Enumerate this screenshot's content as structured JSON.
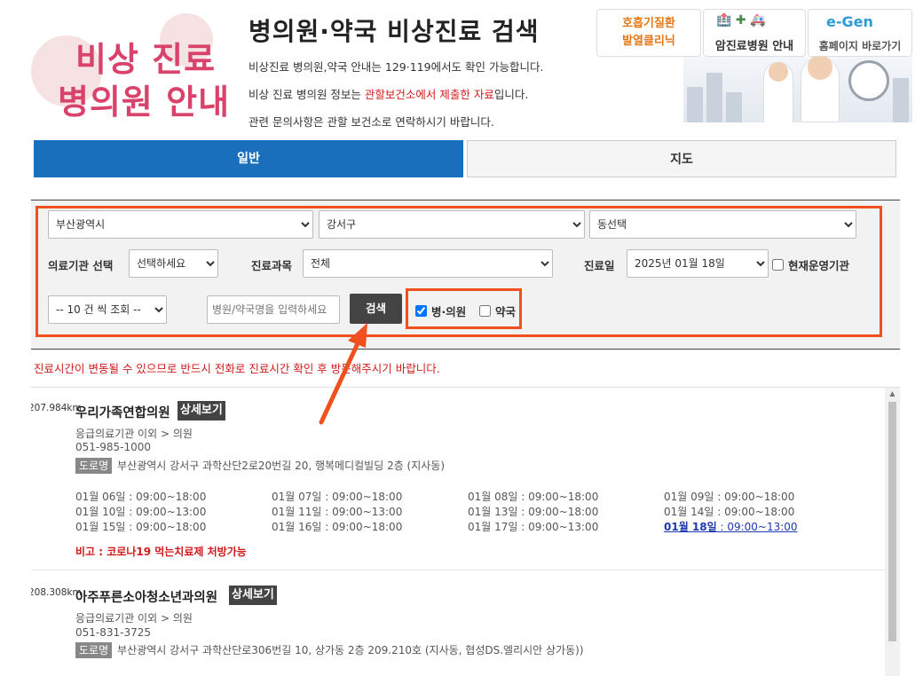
{
  "header": {
    "logo_line1": "비상 진료",
    "logo_line2": "병의원 안내",
    "title": "병의원·약국 비상진료 검색",
    "info1": "비상진료 병의원,약국 안내는 129·119에서도 확인 가능합니다.",
    "info2_pre": "비상 진료 병의원 정보는 ",
    "info2_red": "관할보건소에서 제출한 자료",
    "info2_post": "입니다.",
    "info3": "관련 문의사항은 관할 보건소로 연락하시기 바랍니다.",
    "banners": [
      {
        "line1": "호흡기질환",
        "line2": "발열클리닉"
      },
      {
        "label": "암진료병원 안내",
        "icons": "🏥 ✚ 🚑"
      },
      {
        "label": "홈페이지 바로가기",
        "logo_text": "e-Gen"
      }
    ]
  },
  "tabs": {
    "general": "일반",
    "map": "지도"
  },
  "search": {
    "city": "부산광역시",
    "district": "강서구",
    "dong": "동선택",
    "type_label": "의료기관 선택",
    "type_value": "선택하세요",
    "dept_label": "진료과목",
    "dept_value": "전체",
    "date_label": "진료일",
    "date_value": "2025년 01월 18일",
    "now_open_label": "현재운영기관",
    "now_open_checked": false,
    "count_value": "-- 10 건 씩 조회 --",
    "name_placeholder": "병원/약국명을 입력하세요",
    "search_button": "검색",
    "hospital_label": "병·의원",
    "hospital_checked": true,
    "pharmacy_label": "약국",
    "pharmacy_checked": false
  },
  "notice": "진료시간이 변동될 수 있으므로 반드시 전화로 진료시간 확인 후 방문해주시기 바랍니다.",
  "results": [
    {
      "distance": "207.984km",
      "name": "우리가족연합의원",
      "detail_button": "상세보기",
      "category": "응급의료기관 이외 > 의원",
      "phone": "051-985-1000",
      "road_tag": "도로명",
      "address": "부산광역시 강서구 과학산단2로20번길 20, 행복메디컬빌딩 2층 (지사동)",
      "hours": [
        "01월 06일 : 09:00~18:00",
        "01월 07일 : 09:00~18:00",
        "01월 08일 : 09:00~18:00",
        "01월 09일 : 09:00~18:00",
        "01월 10일 : 09:00~13:00",
        "01월 11일 : 09:00~13:00",
        "01월 13일 : 09:00~18:00",
        "01월 14일 : 09:00~18:00",
        "01월 15일 : 09:00~18:00",
        "01월 16일 : 09:00~18:00",
        "01월 17일 : 09:00~13:00"
      ],
      "today_date": "01월 18일",
      "today_time": " : 09:00~13:00",
      "remark": "비고 : 코로나19 먹는치료제 처방가능"
    },
    {
      "distance": "208.308km",
      "name": "아주푸른소아청소년과의원",
      "detail_button": "상세보기",
      "category": "응급의료기관 이외 > 의원",
      "phone": "051-831-3725",
      "road_tag": "도로명",
      "address": "부산광역시 강서구 과학산단로306번길 10, 상가동 2층 209.210호 (지사동, 협성DS.엘리시안 상가동))"
    }
  ],
  "colors": {
    "accent_blue": "#1a6fbd",
    "highlight_orange": "#f0501e",
    "notice_red": "#d21a1a",
    "logo_pink": "#d9436b"
  }
}
